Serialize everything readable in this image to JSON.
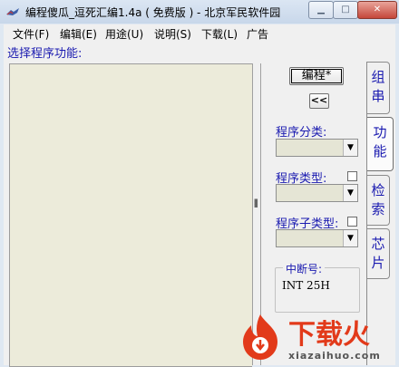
{
  "window": {
    "title": "编程傻瓜_逗死汇编1.4a ( 免费版 ) - 北京军民软件园"
  },
  "menu": [
    {
      "label": "文件(F)"
    },
    {
      "label": "编辑(E)"
    },
    {
      "label": "用途(U)"
    },
    {
      "label": "说明(S)"
    },
    {
      "label": "下载(L)"
    },
    {
      "label": "广告"
    }
  ],
  "main": {
    "section_label": "选择程序功能:"
  },
  "controls": {
    "code_button": "编程*",
    "collapse_button": "<<",
    "category_label": "程序分类:",
    "type_label": "程序类型:",
    "subtype_label": "程序子类型:",
    "interrupt_label": "中断号:",
    "interrupt_value": "INT 25H"
  },
  "tabs": [
    {
      "label": "组串"
    },
    {
      "label": "功能"
    },
    {
      "label": "检索"
    },
    {
      "label": "芯片"
    }
  ],
  "watermark": {
    "brand": "下载火",
    "site": "xiazaihuo.com"
  },
  "colors": {
    "label_blue": "#1a1ab0",
    "editor_bg": "#ecebda",
    "brand_red": "#e23a1a"
  }
}
